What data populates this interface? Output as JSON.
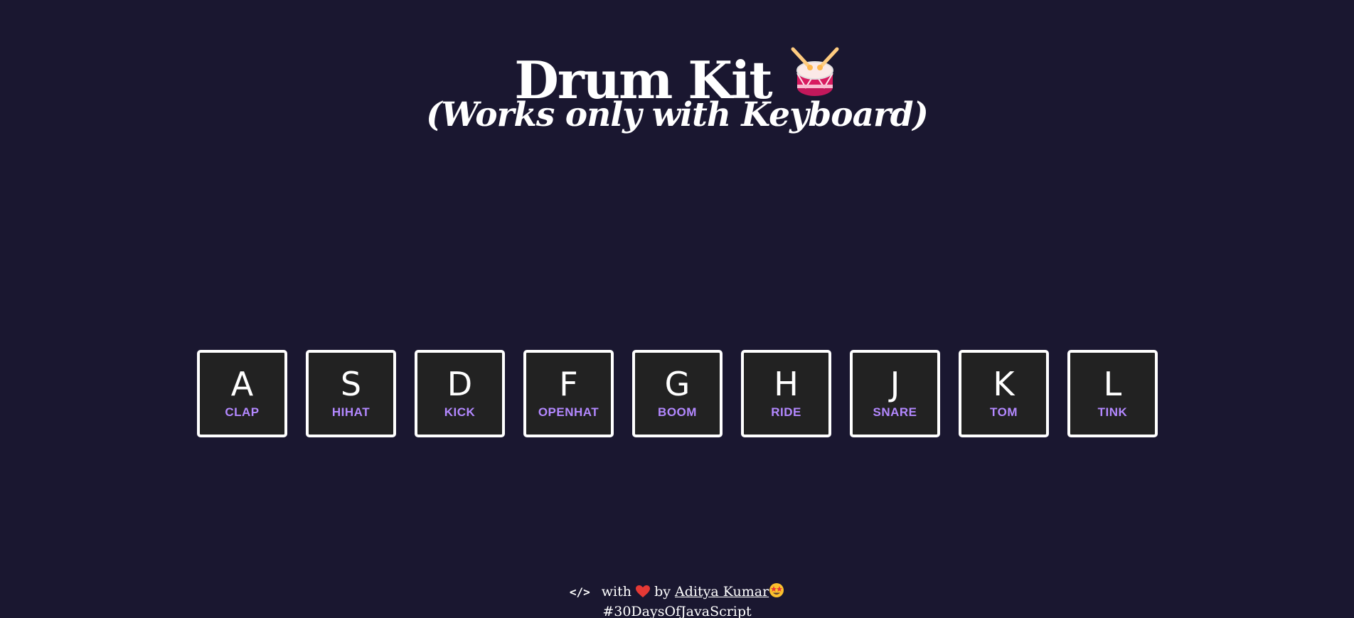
{
  "header": {
    "title": "Drum Kit",
    "icon": "drum-icon",
    "subtitle": "(Works only with Keyboard)"
  },
  "keys": [
    {
      "letter": "A",
      "sound": "CLAP"
    },
    {
      "letter": "S",
      "sound": "HIHAT"
    },
    {
      "letter": "D",
      "sound": "KICK"
    },
    {
      "letter": "F",
      "sound": "OPENHAT"
    },
    {
      "letter": "G",
      "sound": "BOOM"
    },
    {
      "letter": "H",
      "sound": "RIDE"
    },
    {
      "letter": "J",
      "sound": "SNARE"
    },
    {
      "letter": "K",
      "sound": "TOM"
    },
    {
      "letter": "L",
      "sound": "TINK"
    }
  ],
  "footer": {
    "code_symbol": "</>",
    "with_text": "with",
    "heart_icon": "heart-icon",
    "by_text": "by",
    "author": "Aditya Kumar",
    "author_emoji": "star-struck-emoji-icon",
    "hashtag": "#30DaysOfJavaScript"
  },
  "colors": {
    "background": "#1a1730",
    "key_background": "#222222",
    "key_border": "#ffffff",
    "sound_label": "#b388ff",
    "heart": "#e53935"
  }
}
